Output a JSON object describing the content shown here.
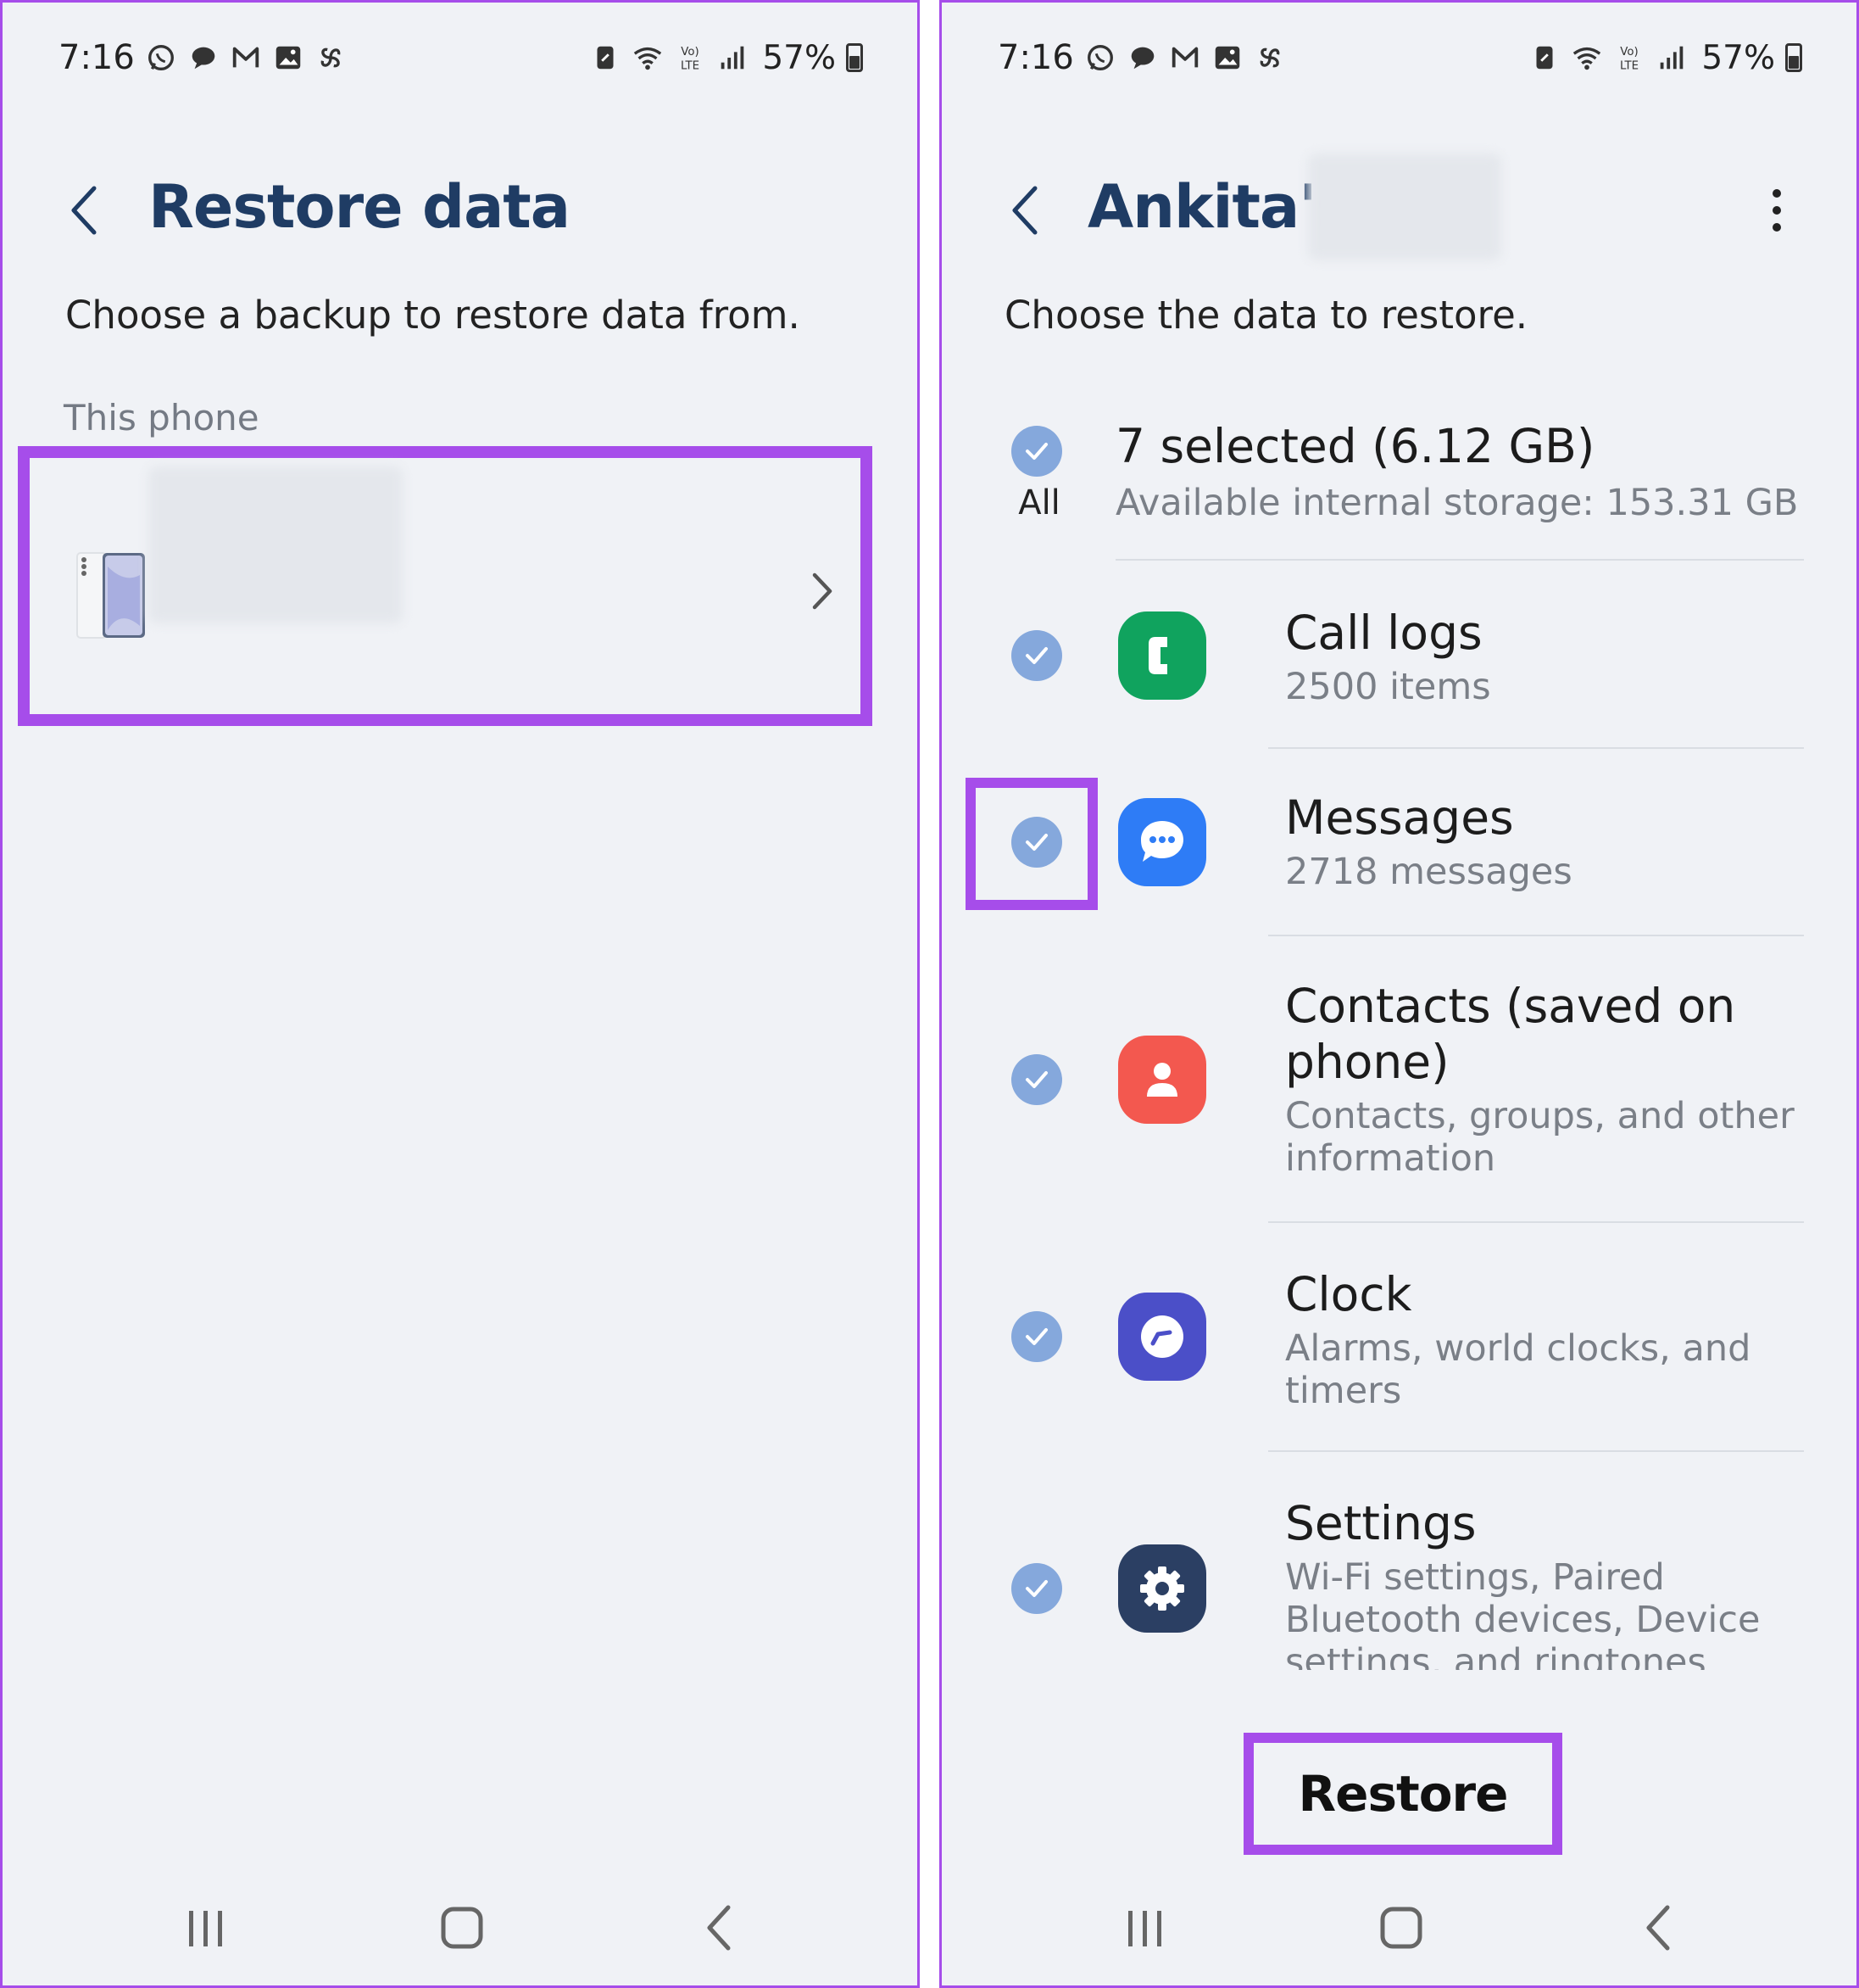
{
  "status_bar": {
    "time": "7:16",
    "battery": "57%",
    "icons": [
      "whatsapp-icon",
      "chat-bubble-icon",
      "gmail-icon",
      "gallery-icon",
      "pinwheel-icon",
      "battery-saver-icon",
      "wifi-icon",
      "volte-lte-icon",
      "signal-icon",
      "battery-icon"
    ]
  },
  "left_screen": {
    "title": "Restore data",
    "subtitle": "Choose a backup to restore data from.",
    "section_label": "This phone",
    "backup_item": {
      "icon": "phone-device-icon",
      "name_blurred": true
    }
  },
  "right_screen": {
    "title": "Ankita's",
    "title_suffix_blurred": true,
    "subtitle": "Choose the data to restore.",
    "select_all": {
      "label": "All",
      "title": "7 selected (6.12 GB)",
      "subtitle": "Available internal storage: 153.31 GB",
      "checked": true
    },
    "items": [
      {
        "title": "Call logs",
        "sub": "2500 items",
        "icon": "call-logs-icon",
        "color": "#10a35e",
        "checked": true
      },
      {
        "title": "Messages",
        "sub": "2718 messages",
        "icon": "messages-icon",
        "color": "#2e7cf6",
        "checked": true
      },
      {
        "title": "Contacts (saved on phone)",
        "sub": "Contacts, groups, and other information",
        "icon": "contacts-icon",
        "color": "#f3584f",
        "checked": true
      },
      {
        "title": "Clock",
        "sub": "Alarms, world clocks, and timers",
        "icon": "clock-icon",
        "color": "#4b4fc8",
        "checked": true
      },
      {
        "title": "Settings",
        "sub": "Wi-Fi settings, Paired Bluetooth devices, Device settings, and ringtones",
        "icon": "settings-icon",
        "color": "#2b3f63",
        "checked": true
      }
    ],
    "restore_button": "Restore"
  },
  "nav": [
    "recents-icon",
    "home-icon",
    "back-icon"
  ],
  "colors": {
    "accent_highlight": "#a64dea",
    "title_navy": "#1f3c64",
    "checkbox": "#85a8dc",
    "background": "#f0f2f6"
  }
}
